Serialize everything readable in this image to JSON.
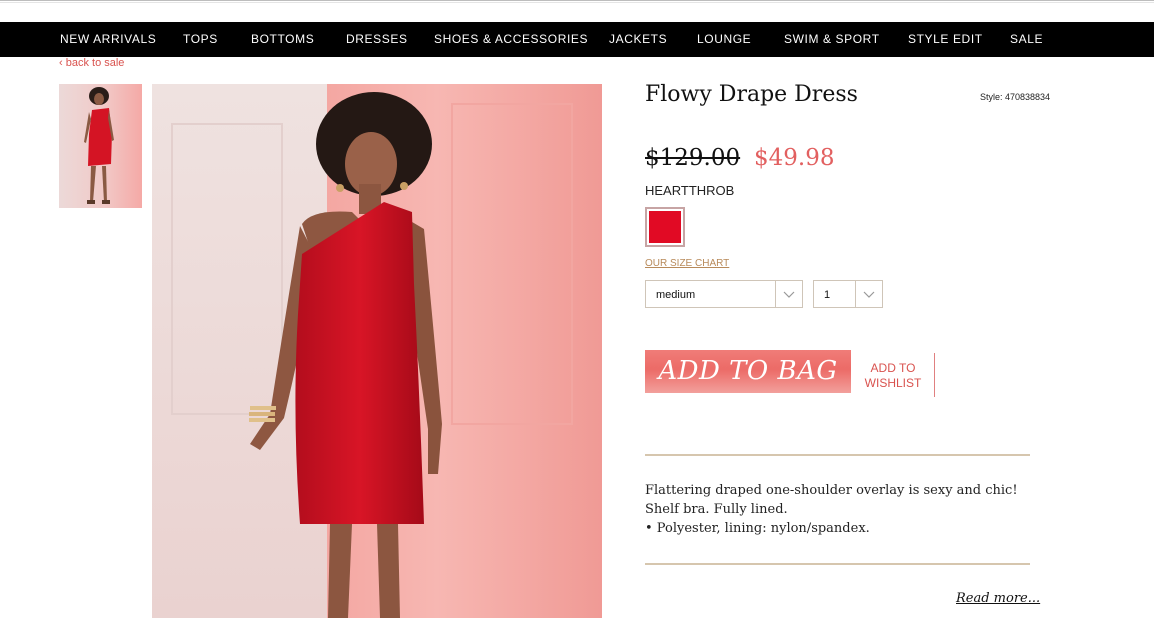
{
  "nav": {
    "items": [
      {
        "label": "NEW ARRIVALS"
      },
      {
        "label": "TOPS"
      },
      {
        "label": "BOTTOMS"
      },
      {
        "label": "DRESSES"
      },
      {
        "label": "SHOES & ACCESSORIES"
      },
      {
        "label": "JACKETS"
      },
      {
        "label": "LOUNGE"
      },
      {
        "label": "SWIM & SPORT"
      },
      {
        "label": "STYLE EDIT"
      },
      {
        "label": "SALE"
      }
    ]
  },
  "breadcrumb": {
    "back_label": "‹ back to sale"
  },
  "product": {
    "title": "Flowy Drape Dress",
    "style_label": "Style: 470838834",
    "original_price": "$129.00",
    "sale_price": "$49.98",
    "color_name": "HEARTTHROB",
    "swatch_color": "#e10a24",
    "size_chart_label": "OUR SIZE CHART",
    "size_value": "medium",
    "quantity_value": "1",
    "add_to_bag_label": "ADD TO BAG",
    "wishlist_line1": "ADD TO",
    "wishlist_line2": "WISHLIST",
    "description_line1": "Flattering draped one-shoulder overlay is sexy and chic! Shelf bra. Fully lined.",
    "description_line2": "• Polyester, lining: nylon/spandex.",
    "read_more_label": "Read more..."
  },
  "colors": {
    "accent": "#e26060",
    "nav_bg": "#000000",
    "add_to_bag_bg": "#ec6b67",
    "rule": "#d6c6ae"
  }
}
